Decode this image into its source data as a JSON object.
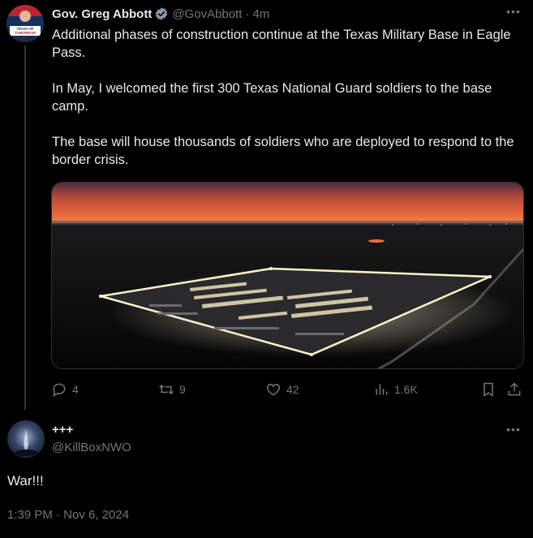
{
  "parent_tweet": {
    "author_name": "Gov. Greg Abbott",
    "handle": "@GovAbbott",
    "separator": "·",
    "time_ago": "4m",
    "avatar_caption": "TEXAS OF TOMORROW",
    "text_paragraphs": [
      "Additional phases of construction continue at the Texas Military Base in Eagle Pass.",
      "In May, I welcomed the first 300 Texas National Guard soldiers to the base camp.",
      "The base will house thousands of soldiers who are deployed to respond to the border crisis."
    ],
    "media_icon": "aerial-photo-military-base-at-dusk",
    "actions": {
      "reply_count": "4",
      "retweet_count": "9",
      "like_count": "42",
      "views_count": "1.6K"
    }
  },
  "reply_tweet": {
    "author_name": "+++",
    "handle": "@KillBoxNWO",
    "text": "War!!!",
    "timestamp": "1:39 PM · Nov 6, 2024"
  },
  "icons": {
    "verified": "verified-badge-icon",
    "more": "more-options-icon",
    "reply": "reply-icon",
    "retweet": "retweet-icon",
    "like": "heart-icon",
    "views": "views-icon",
    "bookmark": "bookmark-icon",
    "share": "share-icon"
  },
  "colors": {
    "background": "#000000",
    "text_primary": "#e7e9ea",
    "text_secondary": "#71767b",
    "verified_blue": "#8899a6",
    "divider": "#2f3336"
  }
}
